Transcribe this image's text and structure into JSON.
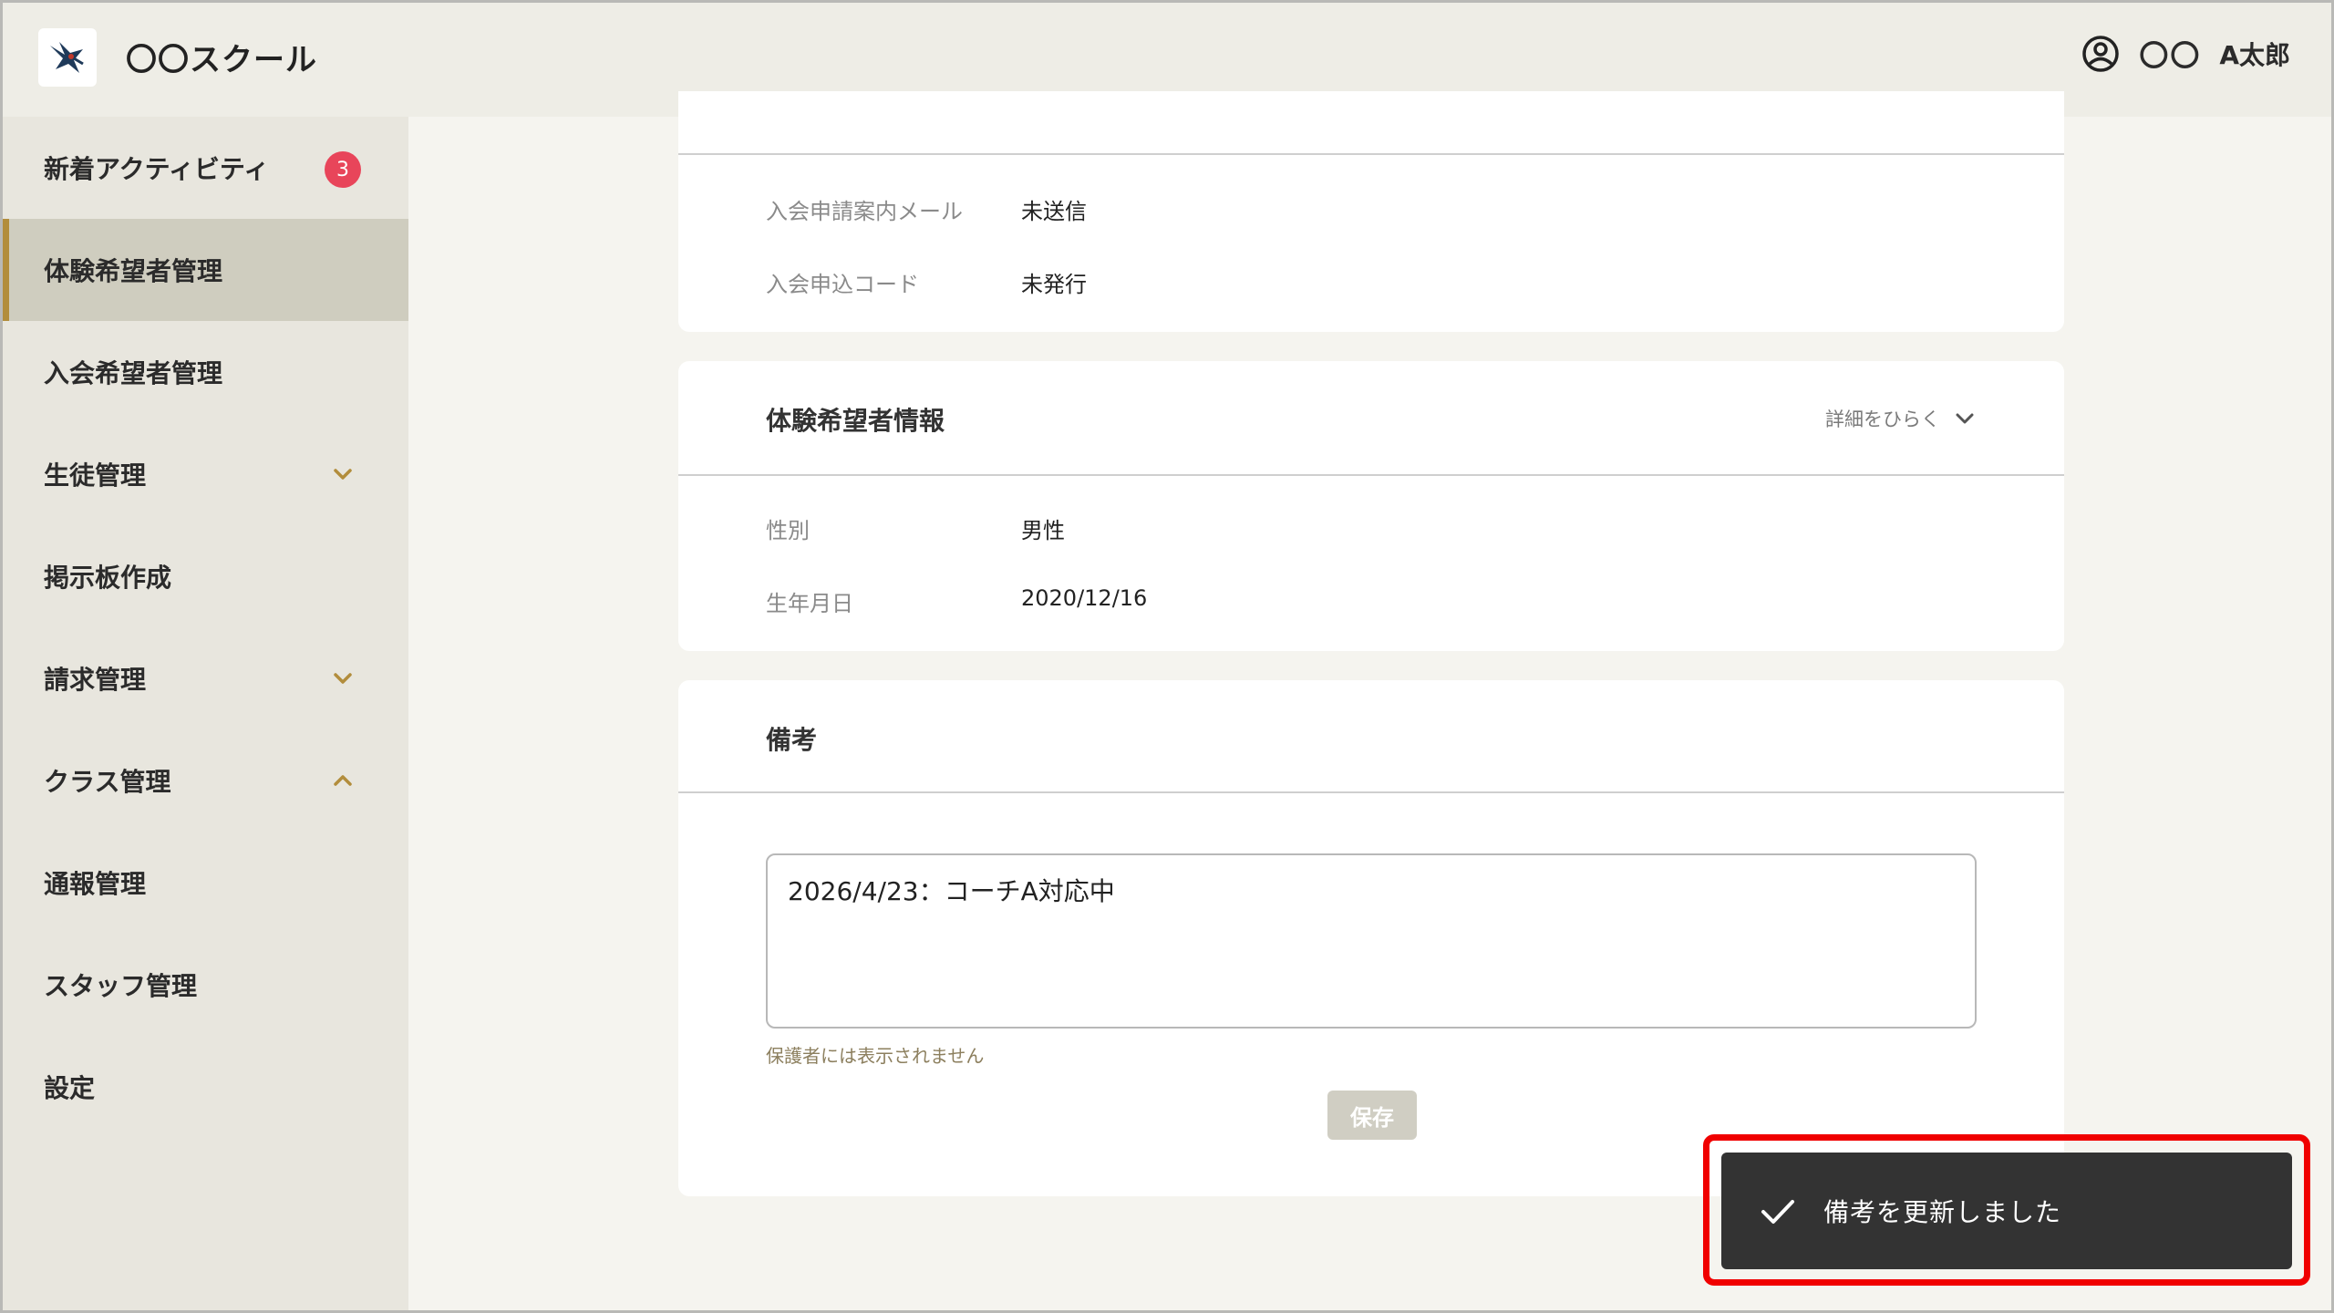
{
  "header": {
    "app_title": "〇〇スクール",
    "user_org": "〇〇",
    "user_name": "A太郎"
  },
  "sidebar": {
    "items": [
      {
        "label": "新着アクティビティ",
        "badge": "3"
      },
      {
        "label": "体験希望者管理",
        "active": true
      },
      {
        "label": "入会希望者管理"
      },
      {
        "label": "生徒管理",
        "chevron": "down"
      },
      {
        "label": "掲示板作成"
      },
      {
        "label": "請求管理",
        "chevron": "down"
      },
      {
        "label": "クラス管理",
        "chevron": "up"
      },
      {
        "label": "通報管理"
      },
      {
        "label": "スタッフ管理"
      },
      {
        "label": "設定"
      }
    ]
  },
  "main": {
    "card1": {
      "rows": [
        {
          "label": "入会申請案内メール",
          "value": "未送信"
        },
        {
          "label": "入会申込コード",
          "value": "未発行"
        }
      ]
    },
    "card2": {
      "title": "体験希望者情報",
      "toggle_label": "詳細をひらく",
      "rows": [
        {
          "label": "性別",
          "value": "男性"
        },
        {
          "label": "生年月日",
          "value": "2020/12/16"
        }
      ]
    },
    "card3": {
      "title": "備考",
      "notes_value": "2026/4/23：コーチA対応中",
      "hint": "保護者には表示されません",
      "save_label": "保存"
    }
  },
  "toast": {
    "message": "備考を更新しました"
  },
  "colors": {
    "accent": "#b28d3c",
    "badge": "#e8455a",
    "highlight": "#f00000",
    "toast_bg": "#333333"
  }
}
